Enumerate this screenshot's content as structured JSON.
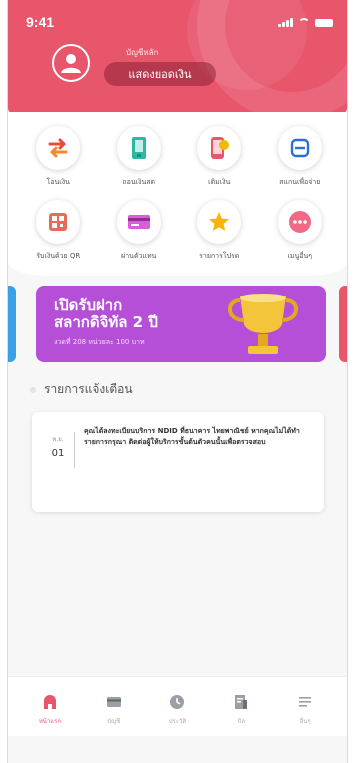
{
  "status_bar": {
    "time": "9:41"
  },
  "header": {
    "account_label": "บัญชีหลัก",
    "balance_button": "แสดงยอดเงิน"
  },
  "quick_menu": [
    {
      "label": "โอนเงิน",
      "icon": "transfer-icon"
    },
    {
      "label": "ถอนเงินสด",
      "icon": "withdraw-cash-icon"
    },
    {
      "label": "เติมเงิน",
      "icon": "topup-icon"
    },
    {
      "label": "สแกนเพื่อจ่าย",
      "icon": "scan-to-pay-icon"
    },
    {
      "label": "รับเงินด้วย QR",
      "icon": "qr-receive-icon"
    },
    {
      "label": "ผ่านตัวแทน",
      "icon": "agent-card-icon"
    },
    {
      "label": "รายการโปรด",
      "icon": "favorite-star-icon"
    },
    {
      "label": "เมนูอื่นๆ",
      "icon": "more-menu-icon"
    }
  ],
  "banner": {
    "line1": "เปิดรับฝาก",
    "line2": "สลากดิจิทัล 2 ปี",
    "line3": "งวดที่ 208 หน่วยละ 100 บาท"
  },
  "notifications": {
    "title": "รายการแจ้งเตือน",
    "items": [
      {
        "month": "พ.ย.",
        "day": "01",
        "text": "คุณได้ลงทะเบียนบริการ NDID ที่ธนาคาร ไทยพาณิชย์ หากคุณไม่ได้ทำรายการกรุณา ติดต่อผู้ให้บริการขั้นต้นตัวคนนั้นเพื่อตรวจสอบ"
      }
    ]
  },
  "bottom_nav": [
    {
      "label": "หน้าแรก",
      "icon": "home-icon",
      "active": true
    },
    {
      "label": "บัญชี",
      "icon": "account-card-icon",
      "active": false
    },
    {
      "label": "ประวัติ",
      "icon": "history-clock-icon",
      "active": false
    },
    {
      "label": "บิล",
      "icon": "bill-icon",
      "active": false
    },
    {
      "label": "อื่นๆ",
      "icon": "menu-lines-icon",
      "active": false
    }
  ],
  "colors": {
    "brand": "#e8566c",
    "banner": "#b54fd8",
    "accent_blue": "#3aa0e8"
  }
}
